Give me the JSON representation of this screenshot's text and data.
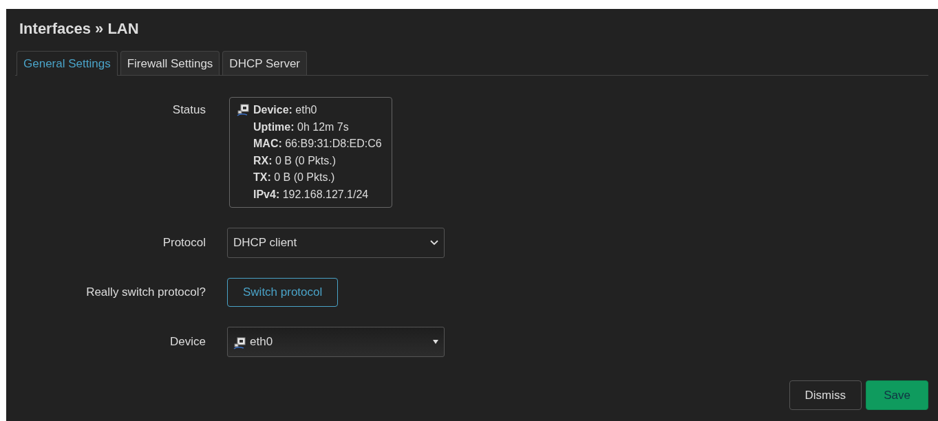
{
  "title": "Interfaces » LAN",
  "tabs": [
    {
      "label": "General Settings",
      "selected": true
    },
    {
      "label": "Firewall Settings",
      "selected": false
    },
    {
      "label": "DHCP Server",
      "selected": false
    }
  ],
  "fields": [
    {
      "kind": "status",
      "label": "Status",
      "lines": [
        "**Device:** eth0",
        "**Uptime:** 0h 12m 7s",
        "**MAC:** 66:B9:31:D8:ED:C6",
        "**RX:** 0 B (0 Pkts.)",
        "**TX:** 0 B (0 Pkts.)",
        "**IPv4:** 192.168.127.1/24"
      ]
    },
    {
      "kind": "select",
      "label": "Protocol",
      "value": "DHCP client"
    },
    {
      "kind": "button",
      "label": "Really switch protocol?",
      "value": "Switch protocol"
    },
    {
      "kind": "device-select",
      "label": "Device",
      "value": "eth0"
    }
  ],
  "buttons": [
    {
      "label": "Dismiss",
      "kind": "secondary"
    },
    {
      "label": "Save",
      "kind": "primary"
    }
  ]
}
